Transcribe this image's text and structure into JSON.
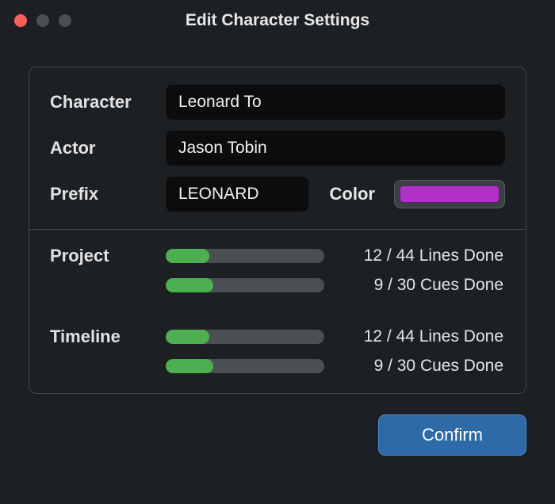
{
  "window": {
    "title": "Edit Character Settings"
  },
  "form": {
    "character_label": "Character",
    "character_value": "Leonard To",
    "actor_label": "Actor",
    "actor_value": "Jason Tobin",
    "prefix_label": "Prefix",
    "prefix_value": "LEONARD",
    "color_label": "Color",
    "color_value": "#b030c8"
  },
  "progress": {
    "project_label": "Project",
    "project_lines": {
      "done": 12,
      "total": 44,
      "text": "12 / 44 Lines Done"
    },
    "project_cues": {
      "done": 9,
      "total": 30,
      "text": "9 / 30 Cues Done"
    },
    "timeline_label": "Timeline",
    "timeline_lines": {
      "done": 12,
      "total": 44,
      "text": "12 / 44 Lines Done"
    },
    "timeline_cues": {
      "done": 9,
      "total": 30,
      "text": "9 / 30 Cues Done"
    }
  },
  "footer": {
    "confirm_label": "Confirm"
  }
}
